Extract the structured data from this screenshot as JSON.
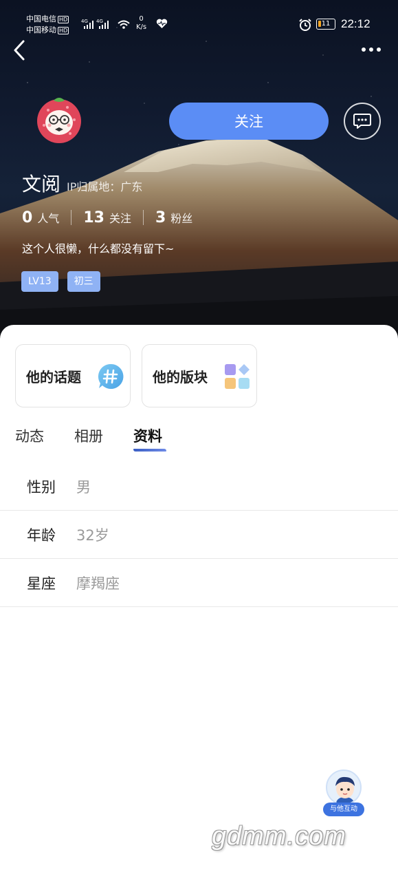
{
  "status_bar": {
    "carrier1": "中国电信",
    "carrier2": "中国移动",
    "hd": "HD",
    "net_speed_value": "0",
    "net_speed_unit": "K/s",
    "battery": "11",
    "time": "22:12"
  },
  "profile": {
    "name": "文阅",
    "ip_location": "IP归属地：广东",
    "stats": [
      {
        "value": "0",
        "label": "人气"
      },
      {
        "value": "13",
        "label": "关注"
      },
      {
        "value": "3",
        "label": "粉丝"
      }
    ],
    "bio": "这个人很懒，什么都没有留下~",
    "tags": [
      "LV13",
      "初三"
    ]
  },
  "actions": {
    "follow_label": "关注"
  },
  "cards": [
    {
      "label": "他的话题",
      "icon": "topic-hash-icon"
    },
    {
      "label": "他的版块",
      "icon": "section-grid-icon"
    }
  ],
  "tabs": [
    "动态",
    "相册",
    "资料"
  ],
  "active_tab": "资料",
  "info": [
    {
      "key": "性别",
      "value": "男"
    },
    {
      "key": "年龄",
      "value": "32岁"
    },
    {
      "key": "星座",
      "value": "摩羯座"
    }
  ],
  "interact": {
    "label": "与他互动"
  },
  "watermark": "gdmm.com",
  "colors": {
    "accent": "#5b8df5",
    "tag_bg": "#8fb2f4",
    "interact_bg": "#3d73e0"
  }
}
